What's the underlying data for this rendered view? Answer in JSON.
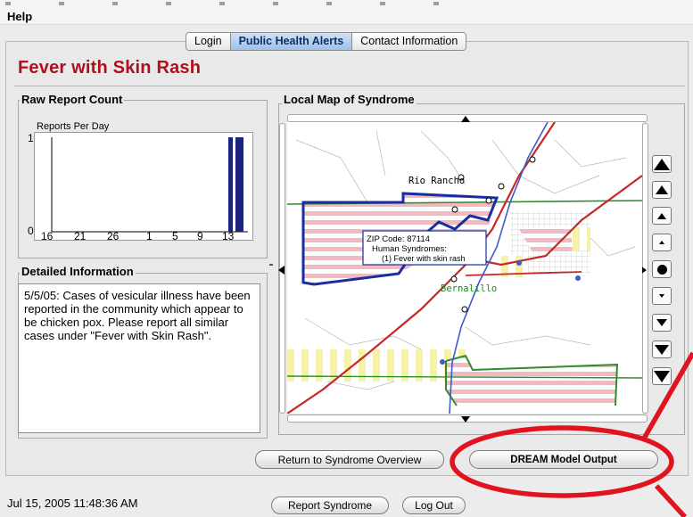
{
  "menu": {
    "help": "Help"
  },
  "tabs": [
    {
      "label": "Login",
      "active": false
    },
    {
      "label": "Public Health Alerts",
      "active": true
    },
    {
      "label": "Contact Information",
      "active": false
    }
  ],
  "page_title": "Fever with Skin Rash",
  "raw_report": {
    "group_label": "Raw Report Count",
    "chart_title": "Reports Per Day",
    "y_ticks": [
      "1",
      "0"
    ],
    "x_ticks": [
      "16",
      "21",
      "26",
      "1",
      "5",
      "9",
      "13"
    ]
  },
  "chart_data": {
    "type": "bar",
    "title": "Reports Per Day",
    "xlabel": "",
    "ylabel": "",
    "ylim": [
      0,
      1
    ],
    "categories": [
      "16",
      "21",
      "26",
      "1",
      "5",
      "9",
      "13"
    ],
    "values": [
      0,
      0,
      0,
      0,
      0,
      0,
      1
    ],
    "bars_near_end": [
      1,
      1
    ]
  },
  "detail": {
    "group_label": "Detailed Information",
    "text": "5/5/05:  Cases of vesicular illness have been reported in the community which appear to be chicken pox. Please report all similar cases under \"Fever with Skin Rash\"."
  },
  "map": {
    "group_label": "Local Map of Syndrome",
    "place_rio_rancho": "Rio Rancho",
    "place_bernalillo": "Bernalillo",
    "tooltip_zip": "ZIP Code: 87114",
    "tooltip_human": "Human Syndromes:",
    "tooltip_case": "(1) Fever with skin rash",
    "zoom_buttons": [
      "zoom-in-largest",
      "zoom-in-large",
      "zoom-in",
      "zoom-in-small",
      "zoom-reset",
      "zoom-out-small",
      "zoom-out",
      "zoom-out-large",
      "zoom-out-largest"
    ]
  },
  "buttons": {
    "return": "Return to Syndrome Overview",
    "dream": "DREAM Model Output",
    "report": "Report Syndrome",
    "logout": "Log Out"
  },
  "status": {
    "timestamp": "Jul 15, 2005 11:48:36 AM"
  },
  "colors": {
    "title_red": "#b0101c",
    "annotation_red": "#e0141e",
    "bar_navy": "#1a237e",
    "zip_outline": "#1a2d9e",
    "stripe_pink": "#f4b8c0",
    "stripe_yellow": "#f5f2a8",
    "boundary_green": "#2e8b2e",
    "road_red": "#c62828"
  }
}
